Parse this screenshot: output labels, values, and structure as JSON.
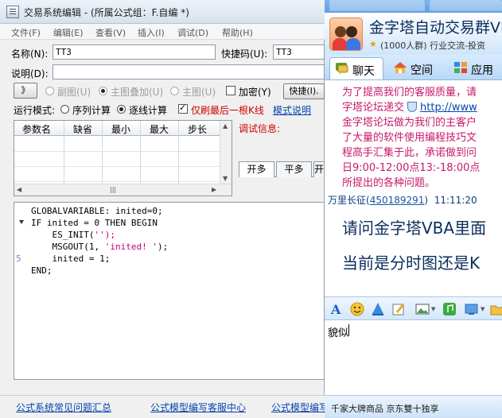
{
  "editor": {
    "title": "交易系统编辑 - (所属公式组：F.自编 *)",
    "menu": [
      "文件(F)",
      "编辑(E)",
      "查看(V)",
      "插入(I)",
      "调试(D)",
      "帮助(H)"
    ],
    "name_label": "名称(N):",
    "name_value": "TT3",
    "shortcut_label": "快捷码(U):",
    "shortcut_value": "TT3",
    "desc_label": "说明(D):",
    "desc_value": "",
    "expand_button": "》",
    "radio_subchart": "副图(U)",
    "radio_main_overlay": "主图叠加(U)",
    "radio_main": "主图(U)",
    "encrypt_label": "加密(Y)",
    "quick_button": "快捷(I).",
    "run_mode_label": "运行模式:",
    "run_mode_sequence": "序列计算",
    "run_mode_bybar": "逐线计算",
    "last_bar_only": "仅刷最后一根K线",
    "mode_help_link": "模式说明",
    "param_headers": [
      "参数名",
      "缺省",
      "最小",
      "最大",
      "步长"
    ],
    "debug_label": "调试信息:",
    "debug_tabs": [
      "开多",
      "平多",
      "开"
    ],
    "line_number_5": "5",
    "code_lines": [
      "GLOBALVARIABLE: inited=0;",
      "IF inited = 0 THEN BEGIN",
      "    ES_INIT(",
      "'');",
      "    MSGOUT(1, ",
      "'inited! '",
      ");",
      "    inited = 1;",
      "END;"
    ],
    "bottom_links": [
      "公式系统常见问题汇总",
      "公式模型编写客服中心",
      "公式模型编写"
    ]
  },
  "chat": {
    "group_name": "金字塔自动交易群VBA",
    "group_sub": "(1000人群) 行业交流-投资",
    "tabs": [
      "聊天",
      "空间",
      "应用"
    ],
    "notice_lines": [
      "为了提高我们的客服质量，请",
      "字塔论坛递交",
      "http://www",
      "金字塔论坛做为我们的主客户",
      "了大量的软件使用编程技巧文",
      "程高手汇集于此，承诺做到问",
      "日9:00-12:00点13:-18:00点",
      "所提出的各种问题。"
    ],
    "sender_name": "万里长征(",
    "sender_qq": "450189291",
    "sender_close": ")",
    "sender_time": "11:11:20",
    "message_line1": "请问金字塔VBA里面",
    "message_line2": "当前是分时图还是K",
    "input_text": "貌似",
    "ad_text": "千家大牌商品 京东雙十独享"
  },
  "colors": {
    "link_blue": "#0645ad",
    "notice_pink": "#c8186b",
    "debug_red": "#d00000",
    "chat_bg": "#dcefff"
  }
}
